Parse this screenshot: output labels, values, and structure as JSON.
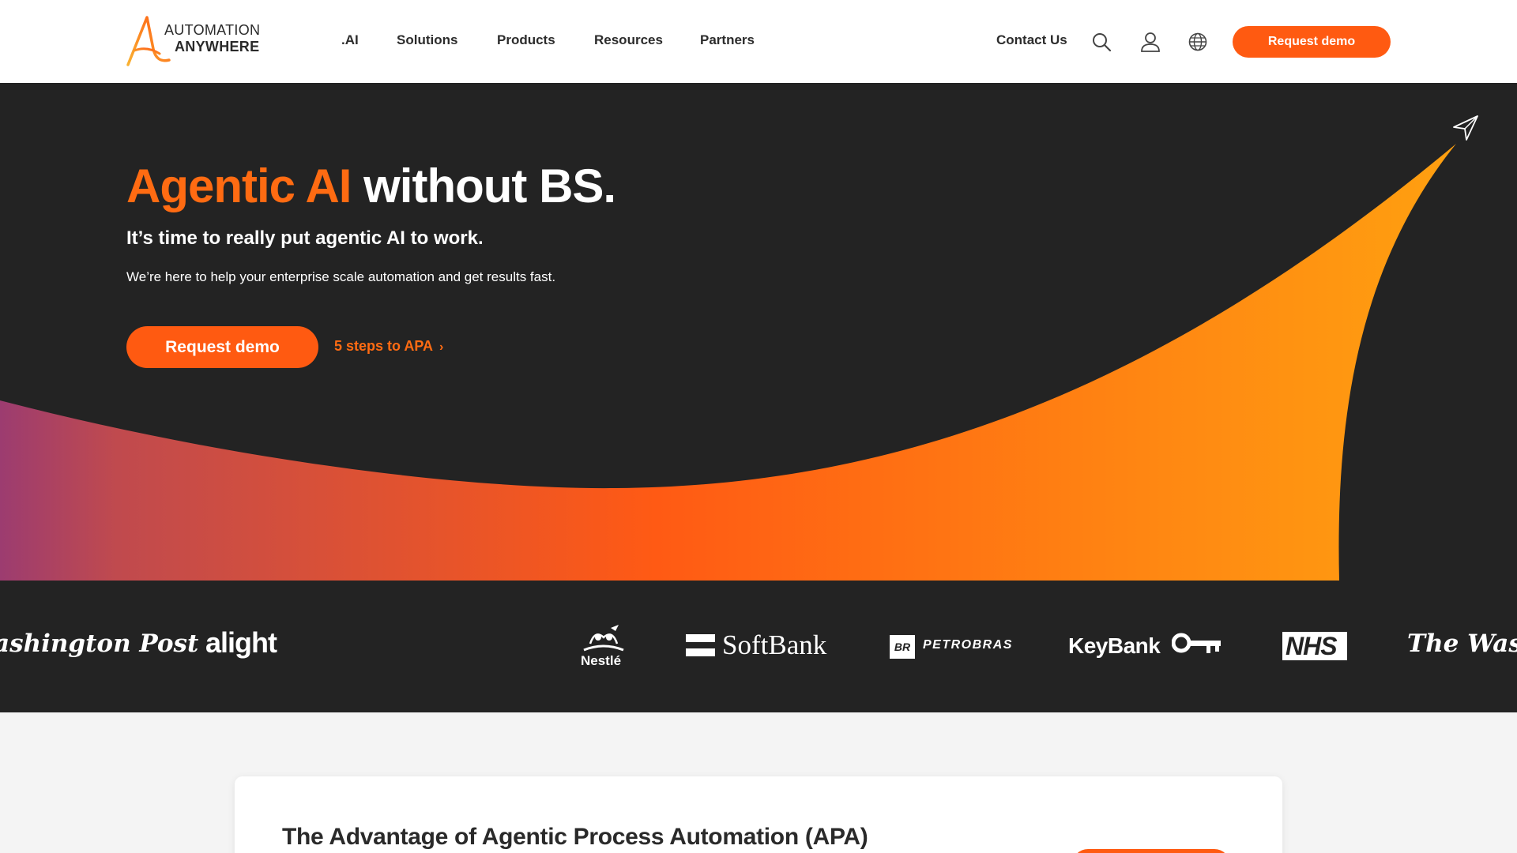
{
  "brand": {
    "logo_line1": "AUTOMATION",
    "logo_line2": "ANYWHERE",
    "accent_color": "#ff5a11"
  },
  "nav": {
    "items": [
      ".AI",
      "Solutions",
      "Products",
      "Resources",
      "Partners"
    ],
    "contact": "Contact Us",
    "request_demo": "Request demo"
  },
  "header_icons": [
    "search-icon",
    "user-icon",
    "globe-icon"
  ],
  "hero": {
    "title_accent": "Agentic AI",
    "title_rest": "without BS.",
    "subtitle": "It’s time to really put agentic AI to work.",
    "description": "We’re here to help your enterprise scale automation and get results fast.",
    "cta": "Request demo",
    "link": "5 steps to APA",
    "icon": "paper-plane-icon"
  },
  "customer_logos": [
    "ashington Post",
    "alight",
    "Nestlé",
    "SoftBank",
    "PETROBRAS",
    "KeyBank",
    "NHS",
    "The Washin"
  ],
  "section": {
    "title": "The Advantage of Agentic Process Automation (APA)"
  }
}
